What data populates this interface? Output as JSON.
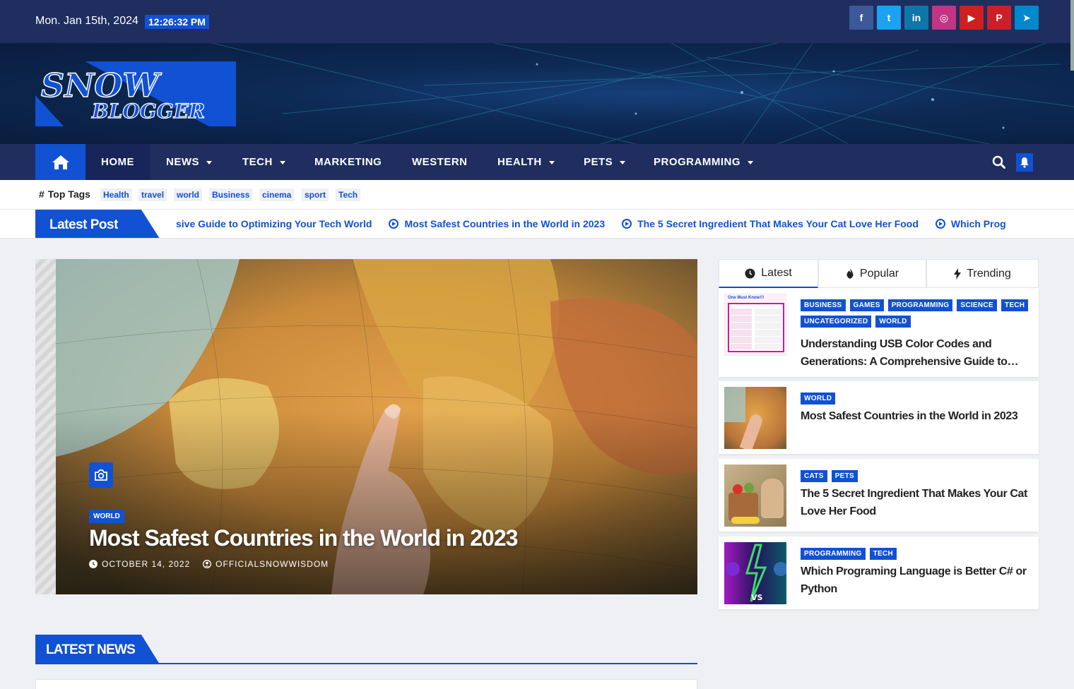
{
  "topbar": {
    "date": "Mon. Jan 15th, 2024",
    "time": "12:26:32 PM"
  },
  "socials": [
    {
      "name": "facebook-icon",
      "glyph": "f",
      "color": "#3b5998"
    },
    {
      "name": "twitter-icon",
      "glyph": "t",
      "color": "#1da1f2"
    },
    {
      "name": "linkedin-icon",
      "glyph": "in",
      "color": "#0e76a8"
    },
    {
      "name": "instagram-icon",
      "glyph": "◎",
      "color": "#c13584"
    },
    {
      "name": "youtube-icon",
      "glyph": "▶",
      "color": "#cd201f"
    },
    {
      "name": "pinterest-icon",
      "glyph": "P",
      "color": "#cb2027"
    },
    {
      "name": "telegram-icon",
      "glyph": "➤",
      "color": "#0088cc"
    }
  ],
  "logo": {
    "line1": "SNOW",
    "line2": "BLOGGER",
    "color": "#1151d3"
  },
  "nav": {
    "items": [
      {
        "label": "HOME",
        "dropdown": false,
        "active": true
      },
      {
        "label": "NEWS",
        "dropdown": true
      },
      {
        "label": "TECH",
        "dropdown": true
      },
      {
        "label": "MARKETING",
        "dropdown": false
      },
      {
        "label": "WESTERN",
        "dropdown": false
      },
      {
        "label": "HEALTH",
        "dropdown": true
      },
      {
        "label": "PETS",
        "dropdown": true
      },
      {
        "label": "PROGRAMMING",
        "dropdown": true
      }
    ]
  },
  "tags": {
    "title": "Top Tags",
    "items": [
      "Health",
      "travel",
      "world",
      "Business",
      "cinema",
      "sport",
      "Tech"
    ]
  },
  "ticker": {
    "label": "Latest Post",
    "items": [
      "sive Guide to Optimizing Your Tech World",
      "Most Safest Countries in the World in 2023",
      "The 5 Secret Ingredient That Makes Your Cat Love Her Food",
      "Which Prog"
    ]
  },
  "hero": {
    "category": "WORLD",
    "title": "Most Safest Countries in the World in 2023",
    "date": "OCTOBER 14, 2022",
    "author": "OFFICIALSNOWWISDOM"
  },
  "sidebar": {
    "tabs": [
      "Latest",
      "Popular",
      "Trending"
    ],
    "posts": [
      {
        "categories": [
          "BUSINESS",
          "GAMES",
          "PROGRAMMING",
          "SCIENCE",
          "TECH",
          "UNCATEGORIZED",
          "WORLD"
        ],
        "title": "Understanding USB Color Codes and Generations: A Comprehensive Guide to…",
        "thumb_text": "One Must Know!!!"
      },
      {
        "categories": [
          "WORLD"
        ],
        "title": "Most Safest Countries in the World in 2023"
      },
      {
        "categories": [
          "CATS",
          "PETS"
        ],
        "title": "The 5 Secret Ingredient That Makes Your Cat Love Her Food"
      },
      {
        "categories": [
          "PROGRAMMING",
          "TECH"
        ],
        "title": "Which Programing Language is Better C# or Python",
        "thumb_text": "VS"
      }
    ]
  },
  "latest_news": {
    "label": "LATEST NEWS"
  },
  "colors": {
    "primary": "#1151d3",
    "dark": "#1f2e5e"
  }
}
